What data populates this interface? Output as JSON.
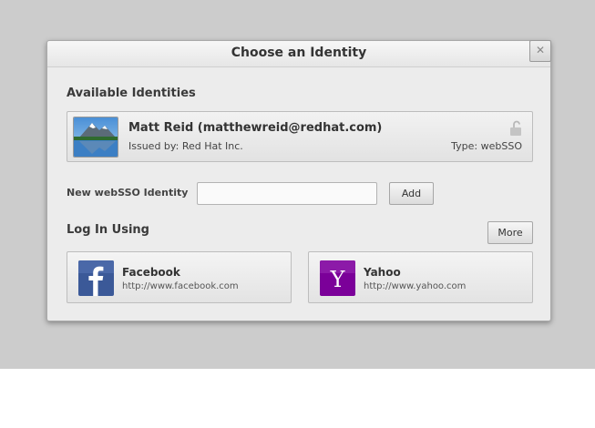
{
  "dialog": {
    "title": "Choose an Identity",
    "close_glyph": "✕"
  },
  "identities": {
    "heading": "Available Identities",
    "items": [
      {
        "name": "Matt Reid (matthewreid@redhat.com)",
        "issuer": "Issued by: Red Hat Inc.",
        "type": "Type: webSSO",
        "avatar_icon": "mountain-landscape",
        "lock_icon": "unlocked-padlock-icon"
      }
    ]
  },
  "new_identity": {
    "label": "New webSSO Identity",
    "value": "",
    "placeholder": "",
    "add_label": "Add"
  },
  "login": {
    "heading": "Log In Using",
    "more_label": "More",
    "providers": [
      {
        "name": "Facebook",
        "url": "http://www.facebook.com",
        "icon": "facebook-icon",
        "color": "#3b5998",
        "glyph": "f"
      },
      {
        "name": "Yahoo",
        "url": "http://www.yahoo.com",
        "icon": "yahoo-icon",
        "color": "#7b0099",
        "glyph": "Y"
      }
    ]
  },
  "colors": {
    "backdrop": "#cccccc",
    "dialog_bg": "#ececec"
  }
}
